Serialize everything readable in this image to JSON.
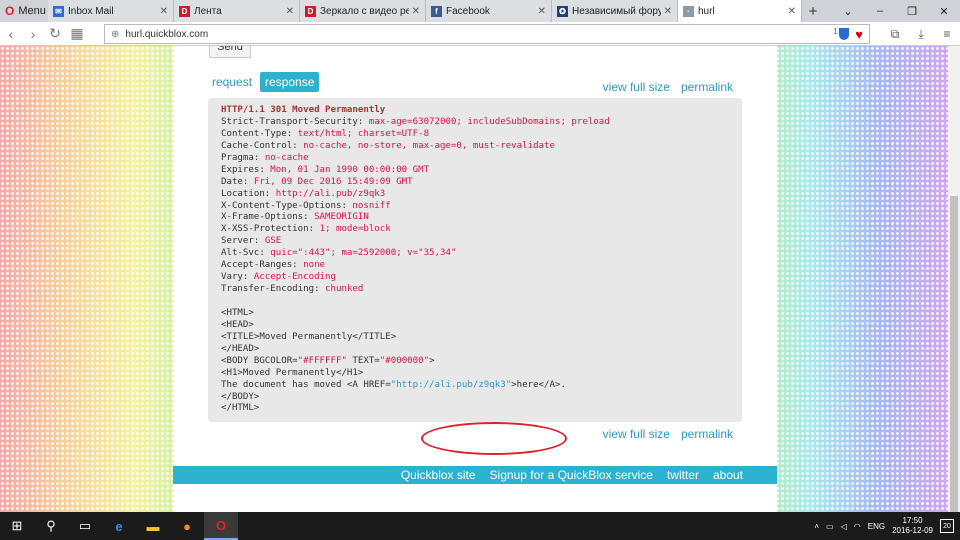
{
  "browser": {
    "menu_label": "Menu",
    "tabs": [
      {
        "label": "Inbox Mail",
        "fav_color": "#2b6dd8",
        "fav_text": "✉"
      },
      {
        "label": "Лента",
        "fav_color": "#d01c2a",
        "fav_text": "D"
      },
      {
        "label": "Зеркало с видео регис",
        "fav_color": "#d01c2a",
        "fav_text": "D"
      },
      {
        "label": "Facebook",
        "fav_color": "#3b5998",
        "fav_text": "f"
      },
      {
        "label": "Независимый форум п",
        "fav_color": "#1d3f7a",
        "fav_text": "✪"
      },
      {
        "label": "hurl",
        "fav_color": "#8a9ba8",
        "fav_text": "·"
      }
    ],
    "url": "hurl.quickblox.com",
    "badge_count": "1"
  },
  "page": {
    "send_label": "Send",
    "tab_request": "request",
    "tab_response": "response",
    "view_full_size": "view full size",
    "permalink": "permalink",
    "response_lines": [
      {
        "k": "HTTP/1.1 301 Moved Permanently",
        "v": "",
        "bold": true
      },
      {
        "k": "Strict-Transport-Security: ",
        "v": "max-age=63072000; includeSubDomains; preload"
      },
      {
        "k": "Content-Type: ",
        "v": "text/html; charset=UTF-8"
      },
      {
        "k": "Cache-Control: ",
        "v": "no-cache, no-store, max-age=0, must-revalidate"
      },
      {
        "k": "Pragma: ",
        "v": "no-cache"
      },
      {
        "k": "Expires: ",
        "v": "Mon, 01 Jan 1990 00:00:00 GMT"
      },
      {
        "k": "Date: ",
        "v": "Fri, 09 Dec 2016 15:49:09 GMT"
      },
      {
        "k": "Location: ",
        "v": "http://ali.pub/z9qk3"
      },
      {
        "k": "X-Content-Type-Options: ",
        "v": "nosniff"
      },
      {
        "k": "X-Frame-Options: ",
        "v": "SAMEORIGIN"
      },
      {
        "k": "X-XSS-Protection: ",
        "v": "1; mode=block"
      },
      {
        "k": "Server: ",
        "v": "GSE"
      },
      {
        "k": "Alt-Svc: ",
        "v": "quic=\":443\"; ma=2592000; v=\"35,34\""
      },
      {
        "k": "Accept-Ranges: ",
        "v": "none"
      },
      {
        "k": "Vary: ",
        "v": "Accept-Encoding"
      },
      {
        "k": "Transfer-Encoding: ",
        "v": "chunked"
      }
    ],
    "body_lines": [
      "<HTML>",
      "<HEAD>",
      "<TITLE>Moved Permanently</TITLE>",
      "</HEAD>"
    ],
    "body_tag": {
      "a": "<BODY BGCOLOR=",
      "b": "\"#FFFFFF\"",
      "c": " TEXT=",
      "d": "\"#000000\"",
      "e": ">"
    },
    "h1_line": "<H1>Moved Permanently</H1>",
    "moved_line": {
      "a": "The document has moved <A HREF=",
      "link": "\"http://ali.pub/z9qk3\"",
      "b": ">here</A>."
    },
    "end_lines": [
      "</BODY>",
      "</HTML>"
    ]
  },
  "footer": {
    "links": [
      "Quickblox site",
      "Signup for a QuickBlox service",
      "twitter",
      "about"
    ]
  },
  "taskbar": {
    "lang": "ENG",
    "time": "17:50",
    "date": "2016-12-09",
    "notif_count": "20"
  },
  "colors": {
    "accent": "#2cb1cf",
    "value_red": "#d14",
    "annotation": "#e0202a"
  }
}
